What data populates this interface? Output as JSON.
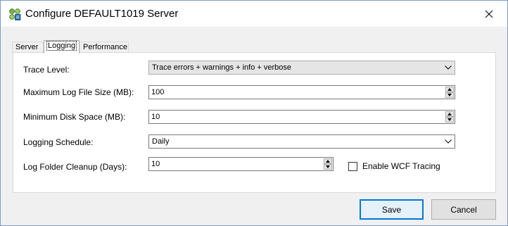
{
  "window": {
    "title": "Configure DEFAULT1019 Server",
    "app_icon": "server-config-icon",
    "close_icon": "close-icon"
  },
  "tabs": [
    {
      "label": "Server",
      "active": false
    },
    {
      "label": "Logging",
      "active": true
    },
    {
      "label": "Performance",
      "active": false
    }
  ],
  "logging": {
    "trace_level": {
      "label": "Trace Level:",
      "value": "Trace errors + warnings + info + verbose"
    },
    "max_log_size": {
      "label": "Maximum Log File Size (MB):",
      "value": "100"
    },
    "min_disk_space": {
      "label": "Minimum Disk Space (MB):",
      "value": "10"
    },
    "schedule": {
      "label": "Logging Schedule:",
      "value": "Daily"
    },
    "cleanup": {
      "label": "Log Folder Cleanup (Days):",
      "value": "10"
    },
    "wcf_tracing": {
      "label": "Enable WCF Tracing",
      "checked": false
    }
  },
  "buttons": {
    "save": "Save",
    "cancel": "Cancel"
  },
  "colors": {
    "accent": "#0078d7",
    "window_border": "#7a9ccf",
    "dialog_bg": "#f0f0f0"
  }
}
